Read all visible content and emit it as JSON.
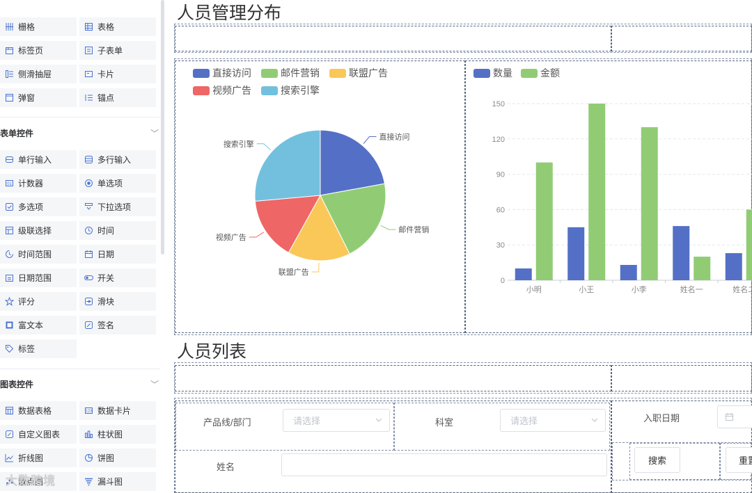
{
  "sidebar": {
    "layout_items": [
      {
        "label": "栅格",
        "icon": "grid-columns-icon"
      },
      {
        "label": "表格",
        "icon": "table-icon"
      },
      {
        "label": "标签页",
        "icon": "tabs-icon"
      },
      {
        "label": "子表单",
        "icon": "subform-icon"
      },
      {
        "label": "侧滑抽屉",
        "icon": "drawer-icon"
      },
      {
        "label": "卡片",
        "icon": "card-icon"
      },
      {
        "label": "弹窗",
        "icon": "dialog-icon"
      },
      {
        "label": "锚点",
        "icon": "anchor-list-icon"
      }
    ],
    "form_section": {
      "title": "表单控件"
    },
    "form_items": [
      {
        "label": "单行输入",
        "icon": "single-input-icon"
      },
      {
        "label": "多行输入",
        "icon": "multi-input-icon"
      },
      {
        "label": "计数器",
        "icon": "counter-icon"
      },
      {
        "label": "单选项",
        "icon": "radio-icon"
      },
      {
        "label": "多选项",
        "icon": "checkbox-icon"
      },
      {
        "label": "下拉选项",
        "icon": "dropdown-icon"
      },
      {
        "label": "级联选择",
        "icon": "cascader-icon"
      },
      {
        "label": "时间",
        "icon": "clock-icon"
      },
      {
        "label": "时间范围",
        "icon": "time-range-icon"
      },
      {
        "label": "日期",
        "icon": "calendar-icon"
      },
      {
        "label": "日期范围",
        "icon": "date-range-icon"
      },
      {
        "label": "开关",
        "icon": "toggle-icon"
      },
      {
        "label": "评分",
        "icon": "star-icon"
      },
      {
        "label": "滑块",
        "icon": "slider-icon"
      },
      {
        "label": "富文本",
        "icon": "rich-text-icon"
      },
      {
        "label": "签名",
        "icon": "signature-icon"
      },
      {
        "label": "标签",
        "icon": "tag-icon"
      }
    ],
    "chart_section": {
      "title": "图表控件"
    },
    "chart_items": [
      {
        "label": "数据表格",
        "icon": "data-table-icon"
      },
      {
        "label": "数据卡片",
        "icon": "data-card-icon"
      },
      {
        "label": "自定义图表",
        "icon": "custom-chart-icon"
      },
      {
        "label": "柱状图",
        "icon": "bar-chart-icon"
      },
      {
        "label": "折线图",
        "icon": "line-chart-icon"
      },
      {
        "label": "饼图",
        "icon": "pie-chart-icon"
      },
      {
        "label": "散点图",
        "icon": "scatter-chart-icon"
      },
      {
        "label": "漏斗图",
        "icon": "funnel-chart-icon"
      }
    ],
    "watermark": "大数跨境"
  },
  "canvas": {
    "section1_title": "人员管理分布",
    "section2_title": "人员列表",
    "search_form": {
      "product_line_label": "产品线/部门",
      "product_line_placeholder": "请选择",
      "department_label": "科室",
      "department_placeholder": "请选择",
      "hire_date_label": "入职日期",
      "name_label": "姓名",
      "search_button": "搜索",
      "reset_button": "重置"
    }
  },
  "chart_data": [
    {
      "type": "pie",
      "title": "",
      "legend_placement": "top-left",
      "slices": [
        {
          "name": "直接访问",
          "value": 335,
          "color": "#5470c6"
        },
        {
          "name": "邮件营销",
          "value": 310,
          "color": "#91cc75"
        },
        {
          "name": "联盟广告",
          "value": 234,
          "color": "#fac858"
        },
        {
          "name": "视频广告",
          "value": 235,
          "color": "#ee6666"
        },
        {
          "name": "搜索引擎",
          "value": 400,
          "color": "#73c0de"
        }
      ]
    },
    {
      "type": "bar",
      "title": "",
      "legend_placement": "top-left",
      "categories": [
        "小明",
        "小王",
        "小李",
        "姓名一",
        "姓名二"
      ],
      "series": [
        {
          "name": "数量",
          "color": "#5470c6",
          "values": [
            10,
            45,
            13,
            46,
            23
          ]
        },
        {
          "name": "金额",
          "color": "#91cc75",
          "values": [
            100,
            150,
            130,
            20,
            60
          ]
        }
      ],
      "ylim": [
        0,
        150
      ],
      "yticks": [
        0,
        30,
        60,
        90,
        120,
        150
      ],
      "grid": true
    }
  ]
}
